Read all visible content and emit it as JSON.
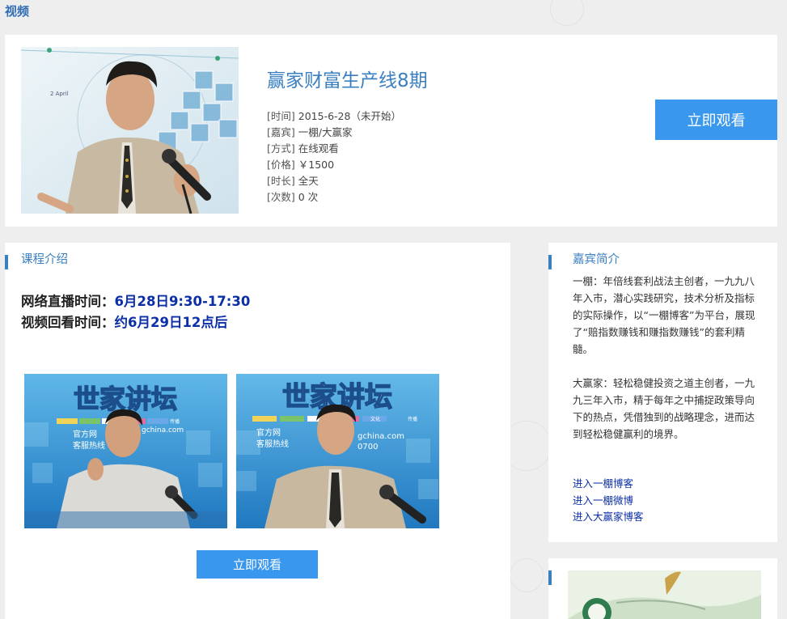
{
  "section": {
    "title": "视频"
  },
  "course": {
    "title": "赢家财富生产线8期",
    "watch_label": "立即观看",
    "info": [
      {
        "label": "[时间]",
        "value": "2015-6-28（未开始）"
      },
      {
        "label": "[嘉宾]",
        "value": "一棚/大赢家"
      },
      {
        "label": "[方式]",
        "value": "在线观看"
      },
      {
        "label": "[价格]",
        "value": "￥1500"
      },
      {
        "label": "[时长]",
        "value": "全天"
      },
      {
        "label": "[次数]",
        "value": "0 次"
      }
    ],
    "thumb_date_text": "2 April"
  },
  "intro": {
    "title": "课程介绍",
    "live_label": "网络直播时间：",
    "live_value": "6月28日9:30-17:30",
    "replay_label": "视频回看时间：",
    "replay_value": "约6月29日12点后",
    "photo_banner": "世家讲坛",
    "photo_small_1": "官方网",
    "photo_small_2": "客服热线",
    "photo_url_text": "gchina.com",
    "photo_phone_text": "0700",
    "photo_tags": [
      "文化",
      "传播"
    ],
    "watch_label": "立即观看"
  },
  "guest": {
    "title": "嘉宾简介",
    "paragraphs": [
      "一棚：年倍线套利战法主创者，一九九八年入市，潜心实践研究，技术分析及指标的实际操作，以“一棚博客”为平台，展现了“赔指数赚钱和赚指数赚钱”的套利精髓。",
      "大赢家：轻松稳健投资之道主创者，一九九三年入市，精于每年之中捕捉政策导向下的热点，凭借独到的战略理念，进而达到轻松稳健赢利的境界。"
    ],
    "links": [
      "进入一棚博客",
      "进入一棚微博",
      "进入大赢家博客"
    ]
  },
  "colors": {
    "accent": "#3a97ee",
    "title_blue": "#3a7fc0",
    "link_blue": "#0b2fa6"
  }
}
